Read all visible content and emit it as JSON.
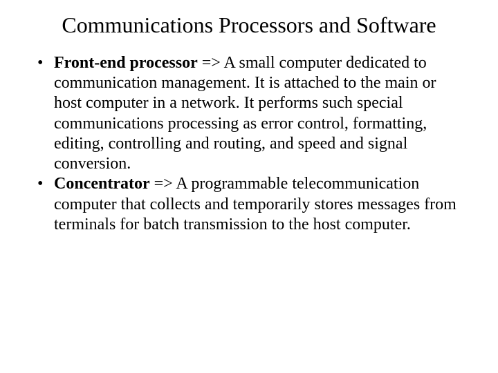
{
  "slide": {
    "title": "Communications Processors and Software",
    "bullets": [
      {
        "term": "Front-end processor",
        "arrow": " => ",
        "definition": "A small computer dedicated to communication management. It is attached to the main or host computer in a network. It performs such special communications processing as error control, formatting, editing, controlling and routing, and speed and signal conversion."
      },
      {
        "term": "Concentrator",
        "arrow": " => ",
        "definition": "A programmable telecommunication computer that collects and temporarily stores messages from terminals for batch transmission to the host computer."
      }
    ]
  }
}
